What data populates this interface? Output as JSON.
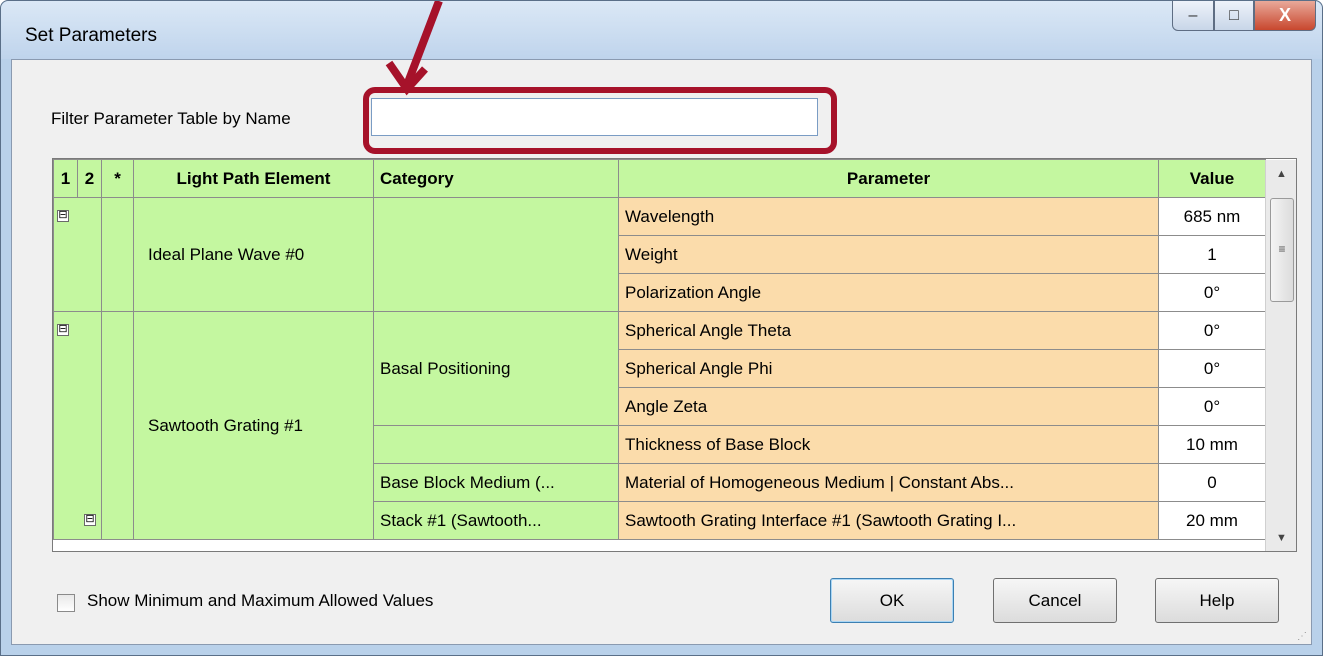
{
  "window": {
    "title": "Set Parameters",
    "controls": {
      "minimize": "–",
      "maximize": "□",
      "close": "X"
    }
  },
  "filter": {
    "label": "Filter Parameter Table by Name",
    "value": ""
  },
  "grid": {
    "headers": {
      "level1": "1",
      "level2": "2",
      "level_star": "*",
      "element": "Light Path Element",
      "category": "Category",
      "parameter": "Parameter",
      "value": "Value"
    },
    "groups": [
      {
        "element": "Ideal Plane Wave #0",
        "expander": "⊟"
      },
      {
        "element": "Sawtooth Grating #1",
        "expander": "⊟"
      }
    ],
    "categories": [
      "",
      "Basal Positioning",
      "",
      "Base Block Medium (...",
      "Stack #1 (Sawtooth..."
    ],
    "rows": [
      {
        "parameter": "Wavelength",
        "value": "685 nm"
      },
      {
        "parameter": "Weight",
        "value": "1"
      },
      {
        "parameter": "Polarization Angle",
        "value": "0°"
      },
      {
        "parameter": "Spherical Angle Theta",
        "value": "0°"
      },
      {
        "parameter": "Spherical Angle Phi",
        "value": "0°"
      },
      {
        "parameter": "Angle Zeta",
        "value": "0°"
      },
      {
        "parameter": "Thickness of Base Block",
        "value": "10 mm"
      },
      {
        "parameter": "Material of Homogeneous Medium | Constant Abs...",
        "value": "0"
      },
      {
        "parameter": "Sawtooth Grating Interface #1 (Sawtooth Grating I...",
        "value": "20 mm"
      }
    ],
    "sub_expander": "⊟",
    "scroll": {
      "up": "▲",
      "down": "▼",
      "thumb": "≡"
    }
  },
  "footer": {
    "checkbox_label": "Show Minimum and Maximum Allowed Values",
    "checkbox_checked": false,
    "ok": "OK",
    "cancel": "Cancel",
    "help": "Help"
  },
  "colors": {
    "header_green": "#c4f7a0",
    "param_orange": "#fbdcab",
    "highlight_red": "#a6122a"
  }
}
